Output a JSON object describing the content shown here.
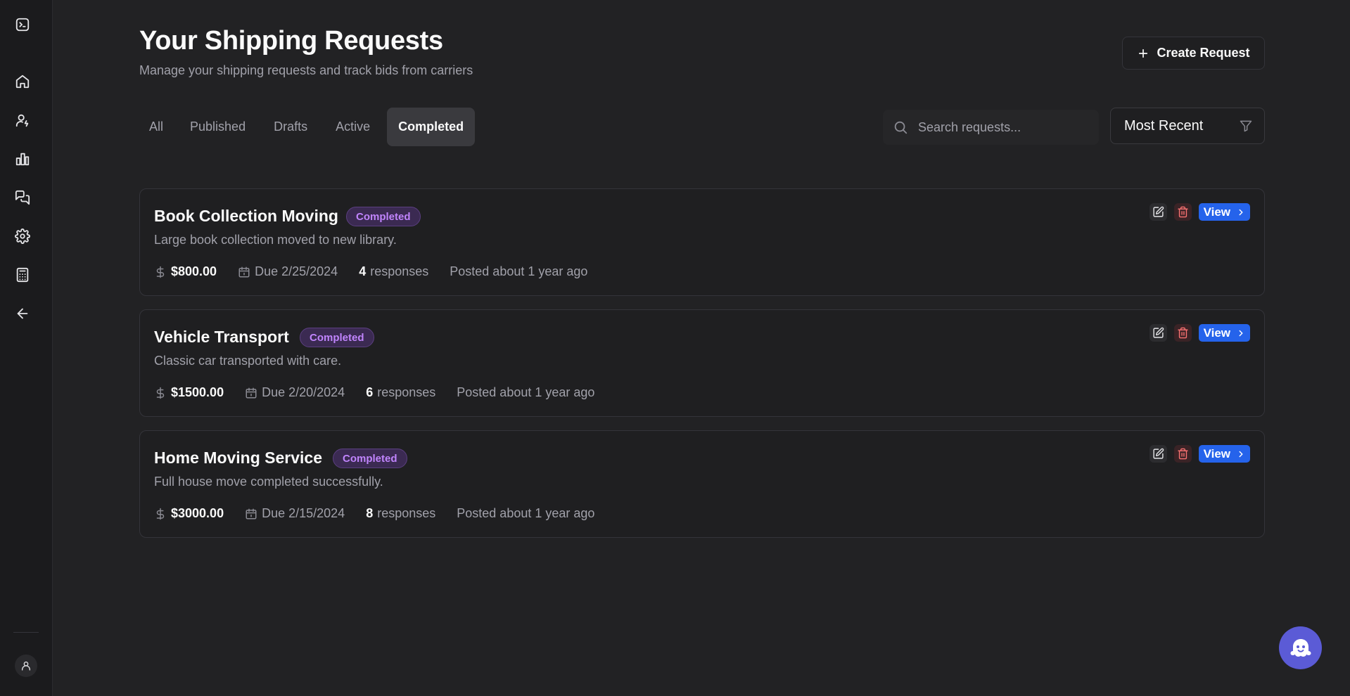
{
  "header": {
    "title": "Your Shipping Requests",
    "subtitle": "Manage your shipping requests and track bids from carriers",
    "create_label": "Create Request"
  },
  "tabs": [
    {
      "label": "All",
      "active": false
    },
    {
      "label": "Published",
      "active": false
    },
    {
      "label": "Drafts",
      "active": false
    },
    {
      "label": "Active",
      "active": false
    },
    {
      "label": "Completed",
      "active": true
    }
  ],
  "search": {
    "placeholder": "Search requests..."
  },
  "sort": {
    "selected": "Most Recent"
  },
  "requests": [
    {
      "title": "Book Collection Moving",
      "status": "Completed",
      "description": "Large book collection moved to new library.",
      "price": "$800.00",
      "due": "Due 2/25/2024",
      "responses_count": "4",
      "responses_label": "responses",
      "posted": "Posted about 1 year ago",
      "view_label": "View"
    },
    {
      "title": "Vehicle Transport",
      "status": "Completed",
      "description": "Classic car transported with care.",
      "price": "$1500.00",
      "due": "Due 2/20/2024",
      "responses_count": "6",
      "responses_label": "responses",
      "posted": "Posted about 1 year ago",
      "view_label": "View"
    },
    {
      "title": "Home Moving Service",
      "status": "Completed",
      "description": "Full house move completed successfully.",
      "price": "$3000.00",
      "due": "Due 2/15/2024",
      "responses_count": "8",
      "responses_label": "responses",
      "posted": "Posted about 1 year ago",
      "view_label": "View"
    }
  ],
  "sidebar": {
    "icons": [
      "terminal-icon",
      "home-icon",
      "user-icon",
      "chart-icon",
      "messages-icon",
      "settings-icon",
      "calculator-icon",
      "arrow-left-icon"
    ]
  },
  "colors": {
    "background": "#222224",
    "accent": "#2563eb",
    "badge_text": "#c084fc",
    "delete": "#f87171",
    "chat": "#5b5bd6"
  }
}
